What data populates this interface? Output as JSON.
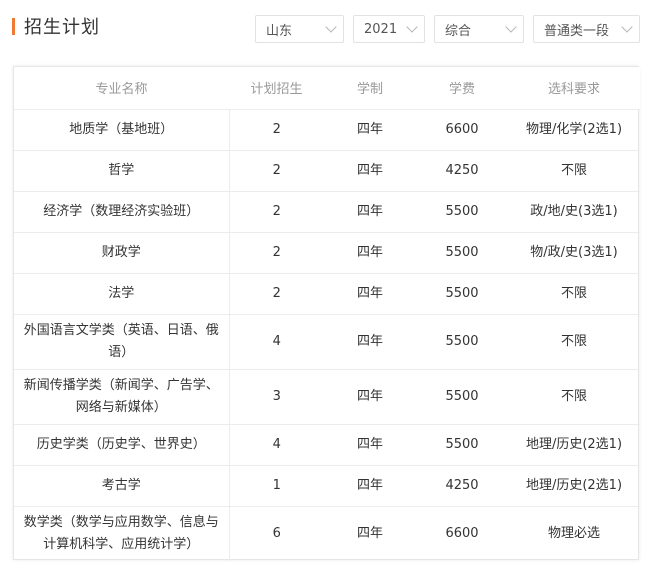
{
  "header": {
    "title": "招生计划"
  },
  "filters": {
    "province": "山东",
    "year": "2021",
    "category": "综合",
    "batch": "普通类一段"
  },
  "table": {
    "columns": [
      "专业名称",
      "计划招生",
      "学制",
      "学费",
      "选科要求"
    ],
    "rows": [
      {
        "name": "地质学（基地班）",
        "plan": "2",
        "duration": "四年",
        "fee": "6600",
        "req": "物理/化学(2选1)"
      },
      {
        "name": "哲学",
        "plan": "2",
        "duration": "四年",
        "fee": "4250",
        "req": "不限"
      },
      {
        "name": "经济学（数理经济实验班）",
        "plan": "2",
        "duration": "四年",
        "fee": "5500",
        "req": "政/地/史(3选1)"
      },
      {
        "name": "财政学",
        "plan": "2",
        "duration": "四年",
        "fee": "5500",
        "req": "物/政/史(3选1)"
      },
      {
        "name": "法学",
        "plan": "2",
        "duration": "四年",
        "fee": "5500",
        "req": "不限"
      },
      {
        "name": "外国语言文学类（英语、日语、俄语）",
        "plan": "4",
        "duration": "四年",
        "fee": "5500",
        "req": "不限"
      },
      {
        "name": "新闻传播学类（新闻学、广告学、网络与新媒体）",
        "plan": "3",
        "duration": "四年",
        "fee": "5500",
        "req": "不限"
      },
      {
        "name": "历史学类（历史学、世界史）",
        "plan": "4",
        "duration": "四年",
        "fee": "5500",
        "req": "地理/历史(2选1)"
      },
      {
        "name": "考古学",
        "plan": "1",
        "duration": "四年",
        "fee": "4250",
        "req": "地理/历史(2选1)"
      },
      {
        "name": "数学类（数学与应用数学、信息与计算机科学、应用统计学）",
        "plan": "6",
        "duration": "四年",
        "fee": "6600",
        "req": "物理必选"
      }
    ]
  }
}
